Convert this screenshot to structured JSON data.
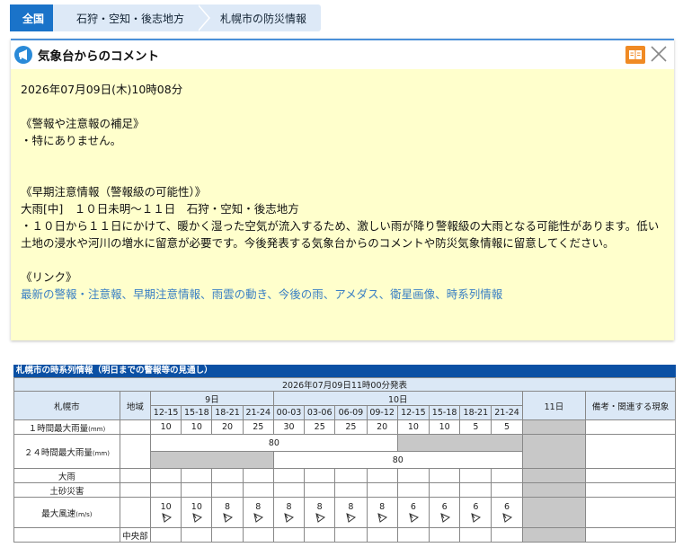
{
  "breadcrumb": {
    "home": "全国",
    "region": "石狩・空知・後志地方",
    "current": "札幌市の防災情報"
  },
  "comment_panel": {
    "title": "気象台からのコメント",
    "datetime": "2026年07月09日(木)10時08分",
    "sec1_heading": "《警報や注意報の補足》",
    "sec1_body": "・特にありません。",
    "sec2_heading": "《早期注意情報（警報級の可能性）》",
    "sec2_line": "大雨[中]　１０日未明～１１日　石狩・空知・後志地方",
    "sec2_body": "・１０日から１１日にかけて、暖かく湿った空気が流入するため、激しい雨が降り警報級の大雨となる可能性があります。低い土地の浸水や河川の増水に留意が必要です。今後発表する気象台からのコメントや防災気象情報に留意してください。",
    "links_heading": "《リンク》",
    "links": [
      "最新の警報・注意報",
      "早期注意情報",
      "雨雲の動き",
      "今後の雨",
      "アメダス",
      "衛星画像",
      "時系列情報"
    ],
    "links_sep": "、"
  },
  "timeseries": {
    "title": "札幌市の時系列情報（明日までの警報等の見通し）",
    "issued": "2026年07月09日11時00分発表",
    "col_city": "札幌市",
    "col_area": "地域",
    "day9": "9日",
    "day10": "10日",
    "day11": "11日",
    "col_notes": "備考・関連する現象",
    "hours9": [
      "12-15",
      "15-18",
      "18-21",
      "21-24"
    ],
    "hours10": [
      "00-03",
      "03-06",
      "06-09",
      "09-12",
      "12-15",
      "15-18",
      "18-21",
      "21-24"
    ],
    "row_rain1h": {
      "label": "１時間最大雨量",
      "unit": "(mm)",
      "values": [
        "10",
        "10",
        "20",
        "25",
        "30",
        "25",
        "25",
        "20",
        "10",
        "10",
        "5",
        "5"
      ]
    },
    "row_rain24h": {
      "label": "２４時間最大雨量",
      "unit": "(mm)",
      "value_a": "80",
      "value_b": "80"
    },
    "row_heavyrain": {
      "label": "大雨"
    },
    "row_landslide": {
      "label": "土砂災害"
    },
    "row_wind": {
      "label": "最大風速",
      "unit": "(m/s)",
      "values": [
        "10",
        "10",
        "8",
        "8",
        "8",
        "8",
        "8",
        "8",
        "6",
        "6",
        "6",
        "6"
      ],
      "direction": "south-southeast-arrow"
    },
    "row_partial": {
      "label": "",
      "area": "中央部"
    }
  },
  "colors": {
    "accent": "#1a73c9",
    "panel_bg": "#ffffcc",
    "table_header": "#0b50a4",
    "header_cell": "#dbe8f6",
    "gray_cell": "#c8c8c8",
    "link": "#3a7fc4"
  }
}
